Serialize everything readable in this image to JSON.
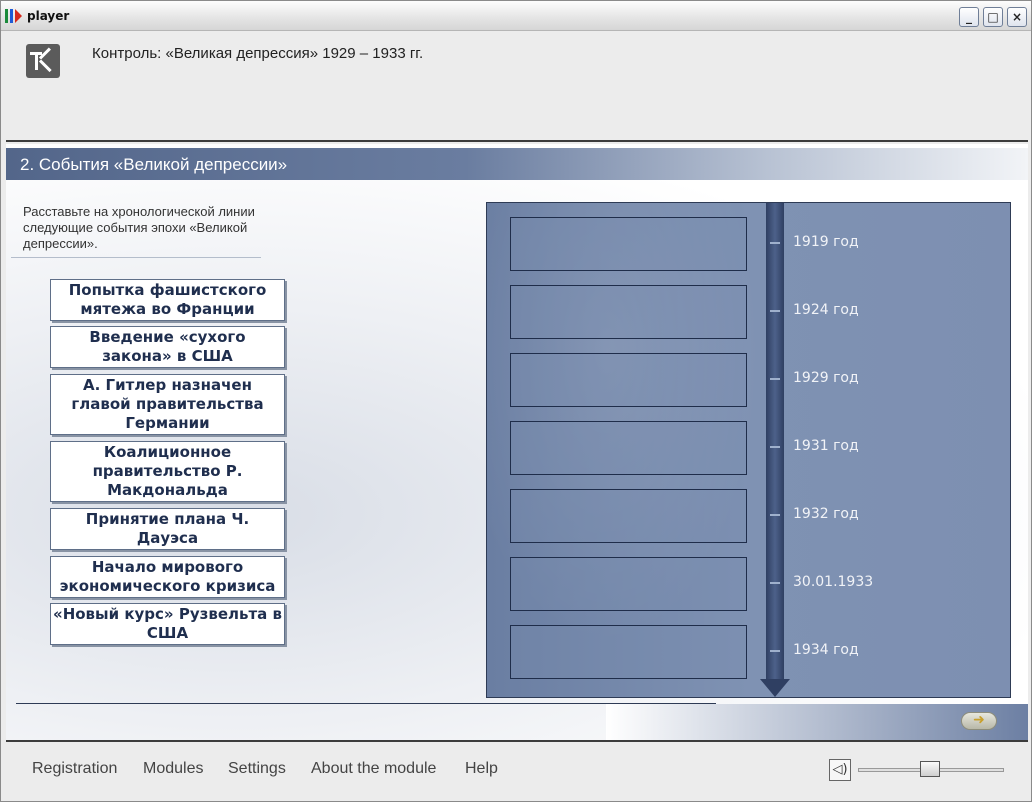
{
  "window": {
    "title": "player",
    "icon_colors": [
      "#1b8a3a",
      "#1e5ad6",
      "#d62a1e"
    ]
  },
  "header": {
    "title": "Контроль: «Великая депрессия» 1929 – 1933 гг.",
    "logo_icon": "k-logo-icon"
  },
  "section": {
    "title": "2. События «Великой депрессии»",
    "instructions": "Расставьте на хронологической линии следующие события эпохи «Великой депрессии»."
  },
  "events": [
    "Попытка фашистского мятежа во Франции",
    "Введение «сухого закона» в США",
    "А. Гитлер назначен главой правительства Германии",
    "Коалиционное правительство Р. Макдональда",
    "Принятие плана Ч. Дауэса",
    "Начало мирового экономического кризиса",
    "«Новый курс» Рузвельта в США"
  ],
  "timeline": {
    "dates": [
      "1919 год",
      "1924 год",
      "1929 год",
      "1931 год",
      "1932 год",
      "30.01.1933",
      "1934 год"
    ]
  },
  "navigation": {
    "next_icon": "arrow-right-icon"
  },
  "footer": {
    "menu": [
      "Registration",
      "Modules",
      "Settings",
      "About the module",
      "Help"
    ],
    "volume_level": 0.5,
    "speaker_icon": "speaker-icon"
  },
  "colors": {
    "accent": "#53668a",
    "timeline_bg": "#7d8fb1",
    "event_text": "#1f2e4e"
  }
}
